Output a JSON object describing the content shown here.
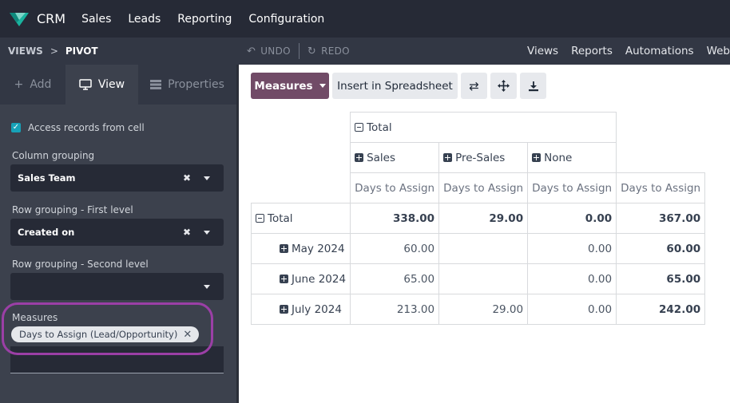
{
  "nav": {
    "app_name": "CRM",
    "items": [
      "Sales",
      "Leads",
      "Reporting",
      "Configuration"
    ]
  },
  "breadcrumb": {
    "parent": "VIEWS",
    "separator": ">",
    "current": "PIVOT"
  },
  "history": {
    "undo": "UNDO",
    "redo": "REDO"
  },
  "right_menu": [
    "Views",
    "Reports",
    "Automations",
    "Web"
  ],
  "panel": {
    "tabs": {
      "add": "Add",
      "view": "View",
      "properties": "Properties"
    },
    "access_records": "Access records from cell",
    "column_grouping": {
      "label": "Column grouping",
      "value": "Sales Team"
    },
    "row_first": {
      "label": "Row grouping - First level",
      "value": "Created on"
    },
    "row_second": {
      "label": "Row grouping - Second level",
      "value": ""
    },
    "measures": {
      "label": "Measures",
      "tag": "Days to Assign (Lead/Opportunity)"
    }
  },
  "toolbar": {
    "measures": "Measures",
    "insert": "Insert in Spreadsheet"
  },
  "pivot": {
    "total": "Total",
    "columns": [
      "Sales",
      "Pre-Sales",
      "None"
    ],
    "measure": "Days to Assign",
    "rows": [
      {
        "label": "Total",
        "values": [
          "338.00",
          "29.00",
          "0.00",
          "367.00"
        ]
      },
      {
        "label": "May 2024",
        "values": [
          "60.00",
          "",
          "0.00",
          "60.00"
        ]
      },
      {
        "label": "June 2024",
        "values": [
          "65.00",
          "",
          "0.00",
          "65.00"
        ]
      },
      {
        "label": "July 2024",
        "values": [
          "213.00",
          "29.00",
          "0.00",
          "242.00"
        ]
      }
    ]
  },
  "colors": {
    "accent": "#714b67",
    "highlight": "#9b3fa6",
    "check": "#17a2b8"
  }
}
